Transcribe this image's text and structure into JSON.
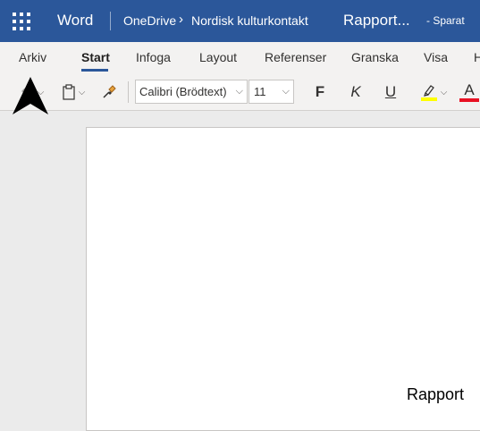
{
  "titlebar": {
    "app_name": "Word",
    "breadcrumb": {
      "root": "OneDrive",
      "separator": "›",
      "folder": "Nordisk kulturkontakt"
    },
    "document_title": "Rapport...",
    "save_status": "-   Sparat"
  },
  "menu": {
    "tabs": [
      {
        "label": "Arkiv"
      },
      {
        "label": "Start"
      },
      {
        "label": "Infoga"
      },
      {
        "label": "Layout"
      },
      {
        "label": "Referenser"
      },
      {
        "label": "Granska"
      },
      {
        "label": "Visa"
      },
      {
        "label": "H"
      }
    ],
    "active_tab": "Start"
  },
  "toolbar": {
    "font_name": "Calibri (Brödtext)",
    "font_size": "11",
    "bold_label": "F",
    "italic_label": "K",
    "underline_label": "U",
    "font_color_label": "A",
    "highlight_color": "#ffff00",
    "font_color": "#e81123",
    "icons": [
      "undo-icon",
      "clipboard-icon",
      "format-painter-icon",
      "highlighter-icon",
      "font-color-icon"
    ]
  },
  "document": {
    "visible_text": "Rapport"
  },
  "colors": {
    "brand": "#2b579a",
    "ribbon_bg": "#f3f2f1",
    "canvas_bg": "#ebebeb"
  }
}
